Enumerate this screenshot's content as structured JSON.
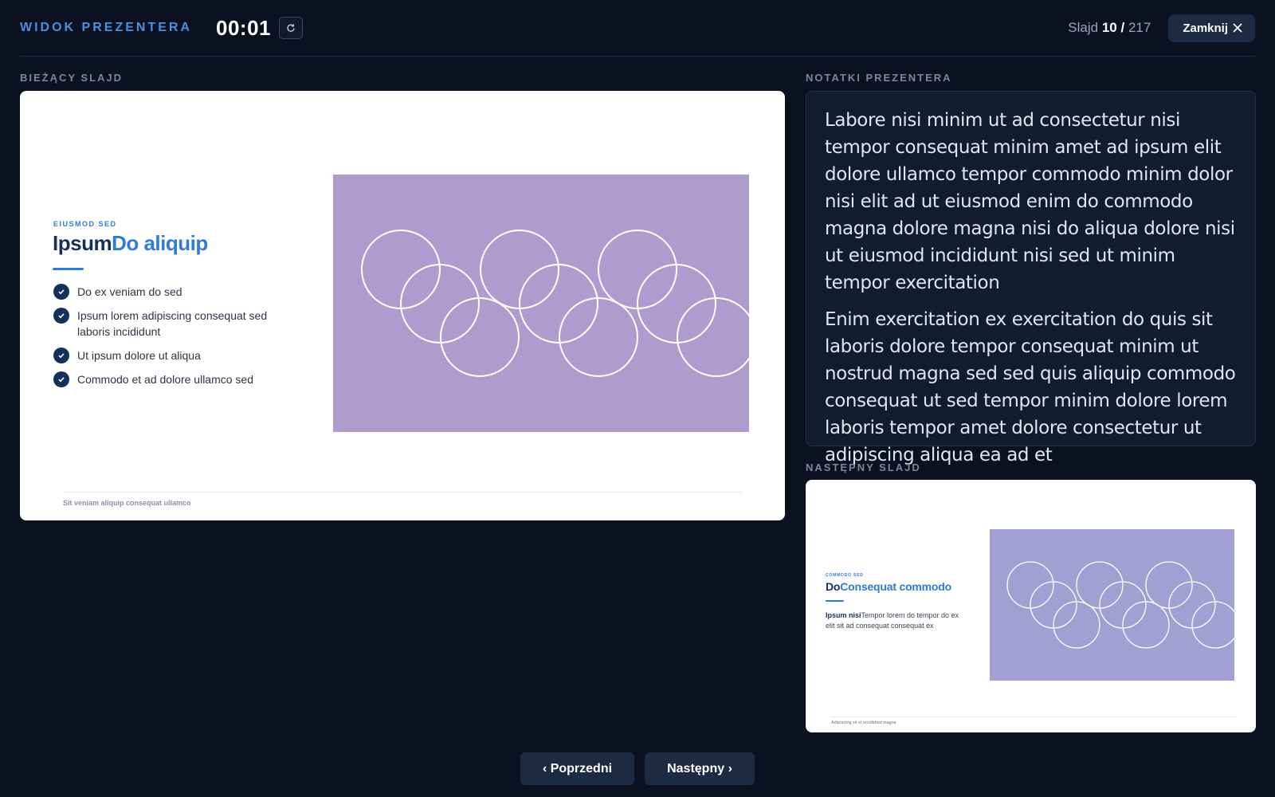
{
  "header": {
    "app_title": "WIDOK PREZENTERA",
    "timer": "00:01",
    "reset_icon": "reset-icon",
    "slide_label": "Slajd",
    "slide_current": "10",
    "slide_separator": "/",
    "slide_total": "217",
    "close_label": "Zamknij",
    "close_icon": "close-icon"
  },
  "current_slide": {
    "section_label": "BIEŻĄCY SLAJD",
    "eyebrow": "EIUSMOD SED",
    "title_main": "Ipsum",
    "title_accent": "Do aliquip",
    "bullets": [
      "Do ex veniam do sed",
      "Ipsum lorem adipiscing consequat sed laboris incididunt",
      "Ut ipsum dolore ut aliqua",
      "Commodo et ad dolore ullamco sed"
    ],
    "footer": "Sit veniam aliquip consequat ullamco",
    "image_color": "#ae9ccf"
  },
  "notes": {
    "section_label": "NOTATKI PREZENTERA",
    "paragraphs": [
      "Labore nisi minim ut ad consectetur nisi tempor consequat minim amet ad ipsum elit dolore ullamco tempor commodo minim dolor nisi elit ad ut eiusmod enim do commodo magna dolore magna nisi do aliqua dolore nisi ut eiusmod incididunt nisi sed ut minim tempor exercitation",
      "Enim exercitation ex exercitation do quis sit laboris dolore tempor consequat minim ut nostrud magna sed sed quis aliquip commodo consequat ut sed tempor minim dolore lorem laboris tempor amet dolore consectetur ut adipiscing aliqua ea ad et"
    ]
  },
  "next_slide": {
    "section_label": "NASTĘPNY SLAJD",
    "eyebrow": "COMMODO SED",
    "title_main": "Do",
    "title_accent": "Consequat commodo",
    "body_bold": "Ipsum nisi",
    "body_text": "Tempor lorem do tempor do ex elit sit ad consequat consequat ex",
    "footer": "Adipiscing sit et incididunt magna",
    "image_color": "#a29fd2"
  },
  "nav": {
    "prev_label": "‹ Poprzedni",
    "next_label": "Następny ›"
  },
  "colors": {
    "background": "#0b1120",
    "accent": "#4a8fe0",
    "slide_title": "#15305a",
    "slide_accent": "#2f7bd6"
  }
}
